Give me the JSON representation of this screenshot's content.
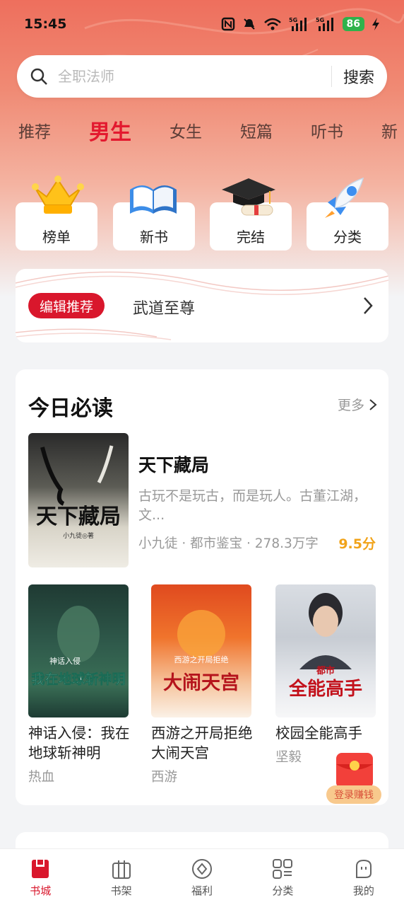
{
  "status_bar": {
    "time": "15:45",
    "battery": "86",
    "icons": [
      "nfc-icon",
      "mute-icon",
      "wifi-icon",
      "signal-5g-icon",
      "signal-5g-icon",
      "charging-icon"
    ]
  },
  "search": {
    "placeholder": "全职法师",
    "button_label": "搜索"
  },
  "tabs": [
    {
      "label": "推荐",
      "active": false
    },
    {
      "label": "男生",
      "active": true
    },
    {
      "label": "女生",
      "active": false
    },
    {
      "label": "短篇",
      "active": false
    },
    {
      "label": "听书",
      "active": false
    },
    {
      "label": "新",
      "active": false
    }
  ],
  "quick_entries": [
    {
      "label": "榜单",
      "icon": "crown-icon"
    },
    {
      "label": "新书",
      "icon": "book-icon"
    },
    {
      "label": "完结",
      "icon": "graduation-cap-icon"
    },
    {
      "label": "分类",
      "icon": "rocket-icon"
    }
  ],
  "editor_pick": {
    "badge": "编辑推荐",
    "title": "武道至尊"
  },
  "today": {
    "title": "今日必读",
    "more_label": "更多",
    "featured": {
      "title": "天下藏局",
      "description": "古玩不是玩古，而是玩人。古董江湖，文...",
      "meta": "小九徒 · 都市鉴宝 · 278.3万字",
      "score": "9.5分",
      "cover_text": "天下藏局",
      "cover_author": "小九徒◎著"
    },
    "books": [
      {
        "title": "神话入侵：我在地球斩神明",
        "genre": "热血",
        "cover_text": "我在地球斩神明",
        "cover_sub": "神话入侵"
      },
      {
        "title": "西游之开局拒绝大闹天宫",
        "genre": "西游",
        "cover_text": "大闹天宫",
        "cover_sub": "西游之开局拒绝"
      },
      {
        "title": "校园全能高手",
        "genre": "坚毅",
        "cover_text": "全能高手",
        "cover_sub": "都市"
      }
    ]
  },
  "promo": {
    "label": "登录赚钱"
  },
  "bottom_nav": [
    {
      "label": "书城",
      "icon": "bookstore-icon",
      "active": true
    },
    {
      "label": "书架",
      "icon": "bookshelf-icon",
      "active": false
    },
    {
      "label": "福利",
      "icon": "welfare-icon",
      "active": false
    },
    {
      "label": "分类",
      "icon": "category-icon",
      "active": false
    },
    {
      "label": "我的",
      "icon": "profile-icon",
      "active": false
    }
  ],
  "colors": {
    "accent": "#d9172c",
    "score": "#f1a319",
    "header_gradient_top": "#ee6f5d"
  }
}
